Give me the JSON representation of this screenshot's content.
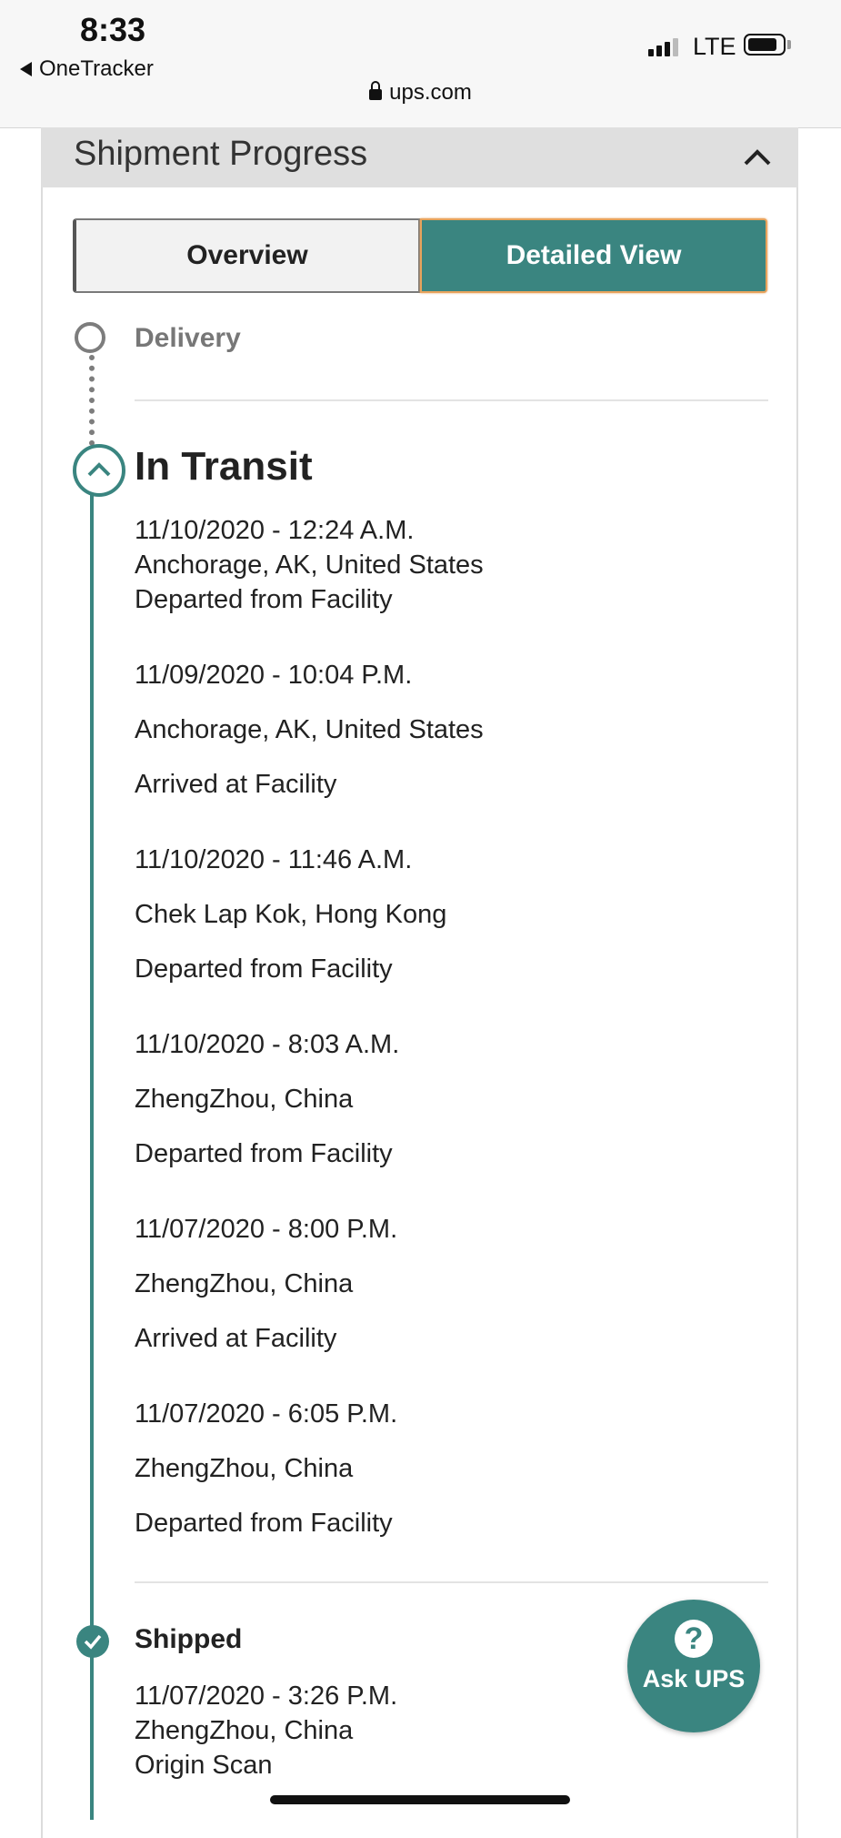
{
  "status_bar": {
    "time": "8:33",
    "back_app": "OneTracker",
    "network": "LTE",
    "url": "ups.com"
  },
  "card": {
    "title": "Shipment Progress"
  },
  "view_toggle": {
    "overview_label": "Overview",
    "detailed_label": "Detailed View",
    "selected": "Detailed View"
  },
  "timeline": {
    "delivery_label": "Delivery",
    "in_transit_label": "In Transit",
    "in_transit_events": [
      {
        "datetime": "11/10/2020 - 12:24 A.M.",
        "location": "Anchorage, AK, United States",
        "status": "Departed from Facility"
      },
      {
        "datetime": "11/09/2020 - 10:04 P.M.",
        "location": "Anchorage, AK, United States",
        "status": "Arrived at Facility"
      },
      {
        "datetime": "11/10/2020 - 11:46 A.M.",
        "location": "Chek Lap Kok, Hong Kong",
        "status": "Departed from Facility"
      },
      {
        "datetime": "11/10/2020 - 8:03 A.M.",
        "location": "ZhengZhou, China",
        "status": "Departed from Facility"
      },
      {
        "datetime": "11/07/2020 - 8:00 P.M.",
        "location": "ZhengZhou, China",
        "status": "Arrived at Facility"
      },
      {
        "datetime": "11/07/2020 - 6:05 P.M.",
        "location": "ZhengZhou, China",
        "status": "Departed from Facility"
      }
    ],
    "shipped_label": "Shipped",
    "shipped_event": {
      "datetime": "11/07/2020 - 3:26 P.M.",
      "location": "ZhengZhou, China",
      "status": "Origin Scan"
    }
  },
  "ask_ups": {
    "label": "Ask UPS",
    "icon_glyph": "?"
  },
  "colors": {
    "accent": "#3a8580",
    "highlight_border": "#e8a35c",
    "inactive": "#7d7d7d"
  },
  "icons": [
    "back-arrow-icon",
    "signal-icon",
    "battery-icon",
    "lock-icon",
    "chevron-up-icon",
    "check-icon",
    "question-icon"
  ]
}
